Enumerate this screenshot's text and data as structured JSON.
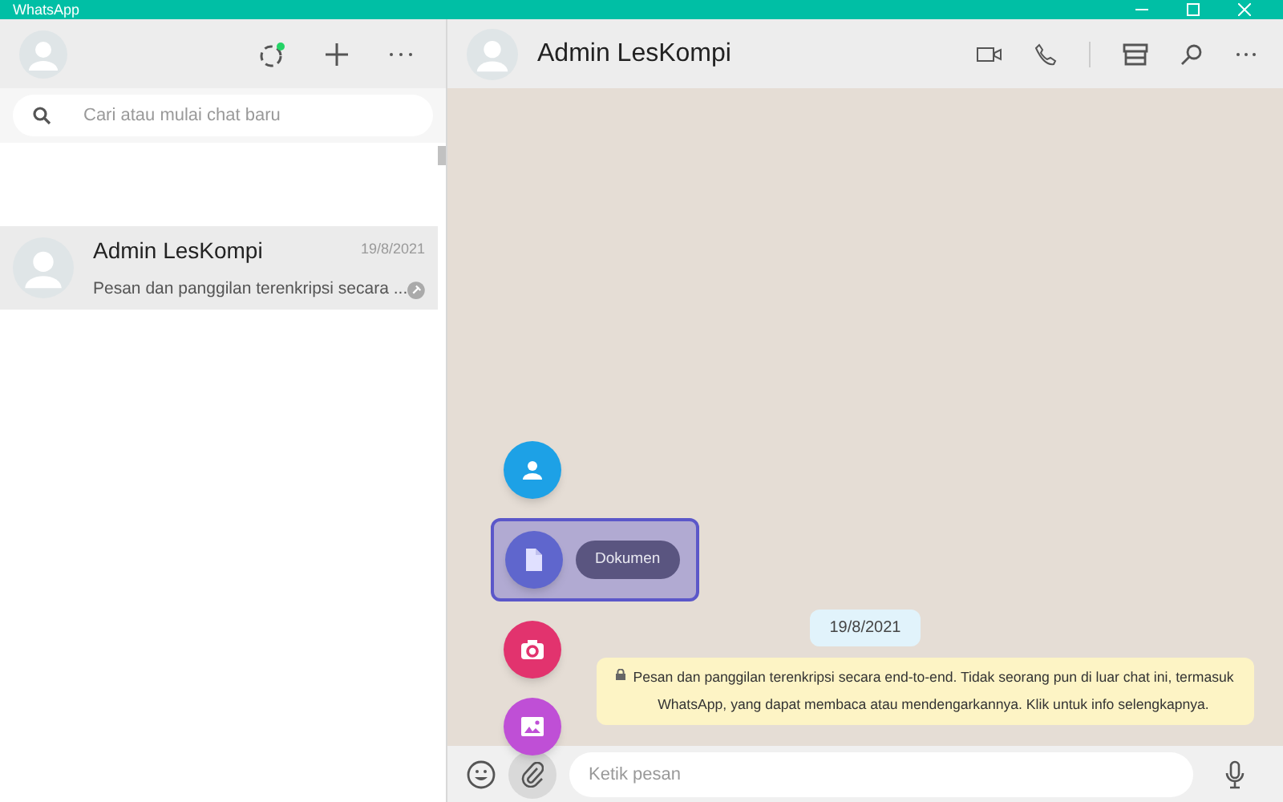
{
  "window": {
    "title": "WhatsApp"
  },
  "sidebar": {
    "search": {
      "placeholder": "Cari atau mulai chat baru"
    },
    "chats": [
      {
        "name": "Admin LesKompi",
        "time": "19/8/2021",
        "preview": "Pesan dan panggilan terenkripsi secara ...",
        "selected": true
      }
    ]
  },
  "chat": {
    "contact": "Admin LesKompi",
    "date_badge": "19/8/2021",
    "system_message": "Pesan dan panggilan terenkripsi secara end-to-end. Tidak seorang pun di luar chat ini, termasuk WhatsApp, yang dapat membaca atau mendengarkannya. Klik untuk info selengkapnya.",
    "attach_menu": [
      {
        "kind": "contact",
        "selected": false
      },
      {
        "kind": "document",
        "label": "Dokumen",
        "selected": true
      },
      {
        "kind": "camera",
        "selected": false
      },
      {
        "kind": "gallery",
        "selected": false
      }
    ],
    "composer": {
      "placeholder": "Ketik pesan"
    }
  }
}
